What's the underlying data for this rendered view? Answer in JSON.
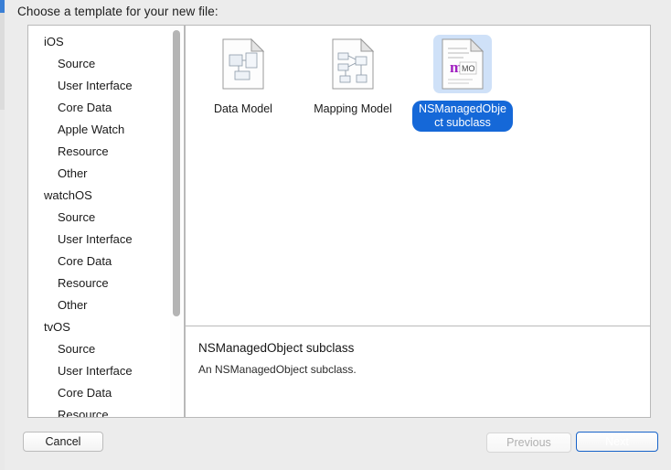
{
  "header": {
    "title": "Choose a template for your new file:"
  },
  "sidebar": {
    "items": [
      {
        "label": "iOS",
        "type": "group"
      },
      {
        "label": "Source",
        "type": "child"
      },
      {
        "label": "User Interface",
        "type": "child"
      },
      {
        "label": "Core Data",
        "type": "child"
      },
      {
        "label": "Apple Watch",
        "type": "child"
      },
      {
        "label": "Resource",
        "type": "child"
      },
      {
        "label": "Other",
        "type": "child"
      },
      {
        "label": "watchOS",
        "type": "group"
      },
      {
        "label": "Source",
        "type": "child"
      },
      {
        "label": "User Interface",
        "type": "child"
      },
      {
        "label": "Core Data",
        "type": "child"
      },
      {
        "label": "Resource",
        "type": "child"
      },
      {
        "label": "Other",
        "type": "child"
      },
      {
        "label": "tvOS",
        "type": "group"
      },
      {
        "label": "Source",
        "type": "child"
      },
      {
        "label": "User Interface",
        "type": "child"
      },
      {
        "label": "Core Data",
        "type": "child"
      },
      {
        "label": "Resource",
        "type": "child"
      }
    ]
  },
  "templates": [
    {
      "label": "Data Model",
      "icon": "data-model-document-icon",
      "selected": false
    },
    {
      "label": "Mapping Model",
      "icon": "mapping-model-document-icon",
      "selected": false
    },
    {
      "label": "NSManagedObject subclass",
      "icon": "nsmanagedobject-document-icon",
      "selected": true
    }
  ],
  "description": {
    "title": "NSManagedObject subclass",
    "body": "An NSManagedObject subclass."
  },
  "footer": {
    "cancel_label": "Cancel",
    "previous_label": "Previous",
    "next_label": "Next"
  },
  "colors": {
    "selection_blue": "#1568d8",
    "selection_icon_bg": "#cfe1f8",
    "default_button_blue": "#2279ef",
    "window_bg": "#ececec",
    "panel_bg": "#ffffff",
    "border": "#b9b9b9",
    "icon_accent_purple": "#a020c0"
  }
}
